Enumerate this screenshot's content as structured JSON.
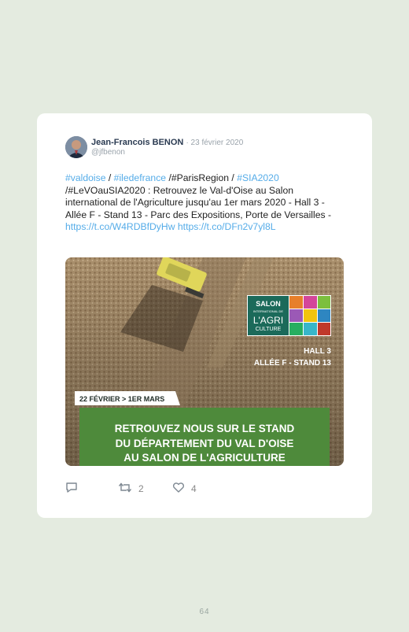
{
  "tweet": {
    "author_name": "Jean-Francois BENON",
    "date": "· 23 février 2020",
    "handle": "@jfbenon",
    "text_parts": {
      "t1": "#valdoise",
      "t2": " / ",
      "t3": "#iledefrance",
      "t4": " /#ParisRegion / ",
      "t5": "#SIA2020",
      "t6": " /#LeVOauSIA2020 : Retrouvez le Val-d'Oise au Salon international de l'Agriculture jusqu'au 1er mars 2020 - Hall 3 - Allée F - Stand 13 - Parc des Expositions, Porte de Versailles - ",
      "t7": "https://t.co/W4RDBfDyHw",
      "t8": " ",
      "t9": "https://t.co/DFn2v7yl8L"
    },
    "media": {
      "logo_line1": "SALON",
      "logo_line2": "INTERNATIONAL DE",
      "logo_line3": "L'AGRI",
      "logo_line4": "CULTURE",
      "hall": "HALL 3",
      "stand": "ALLÉE F - STAND 13",
      "dates": "22 FÉVRIER > 1ER MARS",
      "banner_line1": "RETROUVEZ NOUS SUR LE  STAND",
      "banner_line2": "DU DÉPARTEMENT DU VAL D'OISE",
      "banner_line3": "AU SALON DE L'AGRICULTURE"
    },
    "actions": {
      "retweets": "2",
      "likes": "4"
    }
  },
  "page_number": "64",
  "colors": {
    "background": "#e4ebe0",
    "link": "#55ace8",
    "banner_green": "#4e8a3b",
    "logo_green": "#1b6a5a"
  }
}
